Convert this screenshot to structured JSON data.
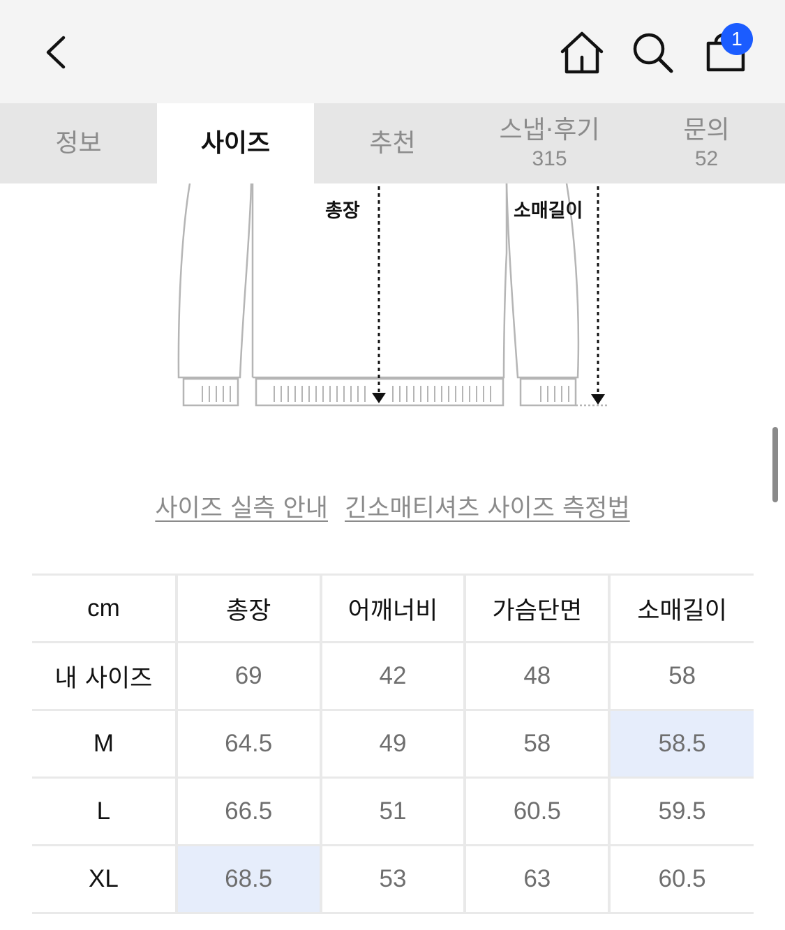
{
  "header": {
    "back_icon": "chevron-left-icon",
    "home_icon": "home-icon",
    "search_icon": "search-icon",
    "cart_icon": "shopping-bag-icon",
    "cart_count": "1",
    "badge_color": "#1b5cff"
  },
  "tabs": [
    {
      "label": "정보",
      "count": ""
    },
    {
      "label": "사이즈",
      "count": ""
    },
    {
      "label": "추천",
      "count": ""
    },
    {
      "label": "스냅·후기",
      "count": "315"
    },
    {
      "label": "문의",
      "count": "52"
    }
  ],
  "diagram": {
    "length_label": "총장",
    "sleeve_label": "소매길이"
  },
  "links": {
    "size_guide": "사이즈 실측 안내",
    "measure_method": "긴소매티셔츠 사이즈 측정법"
  },
  "size_table": {
    "headers": [
      "cm",
      "총장",
      "어깨너비",
      "가슴단면",
      "소매길이"
    ],
    "rows": [
      {
        "label": "내 사이즈",
        "values": [
          "69",
          "42",
          "48",
          "58"
        ]
      },
      {
        "label": "M",
        "values": [
          "64.5",
          "49",
          "58",
          "58.5"
        ]
      },
      {
        "label": "L",
        "values": [
          "66.5",
          "51",
          "60.5",
          "59.5"
        ]
      },
      {
        "label": "XL",
        "values": [
          "68.5",
          "53",
          "63",
          "60.5"
        ]
      }
    ],
    "highlight_color": "#e6edfb"
  }
}
